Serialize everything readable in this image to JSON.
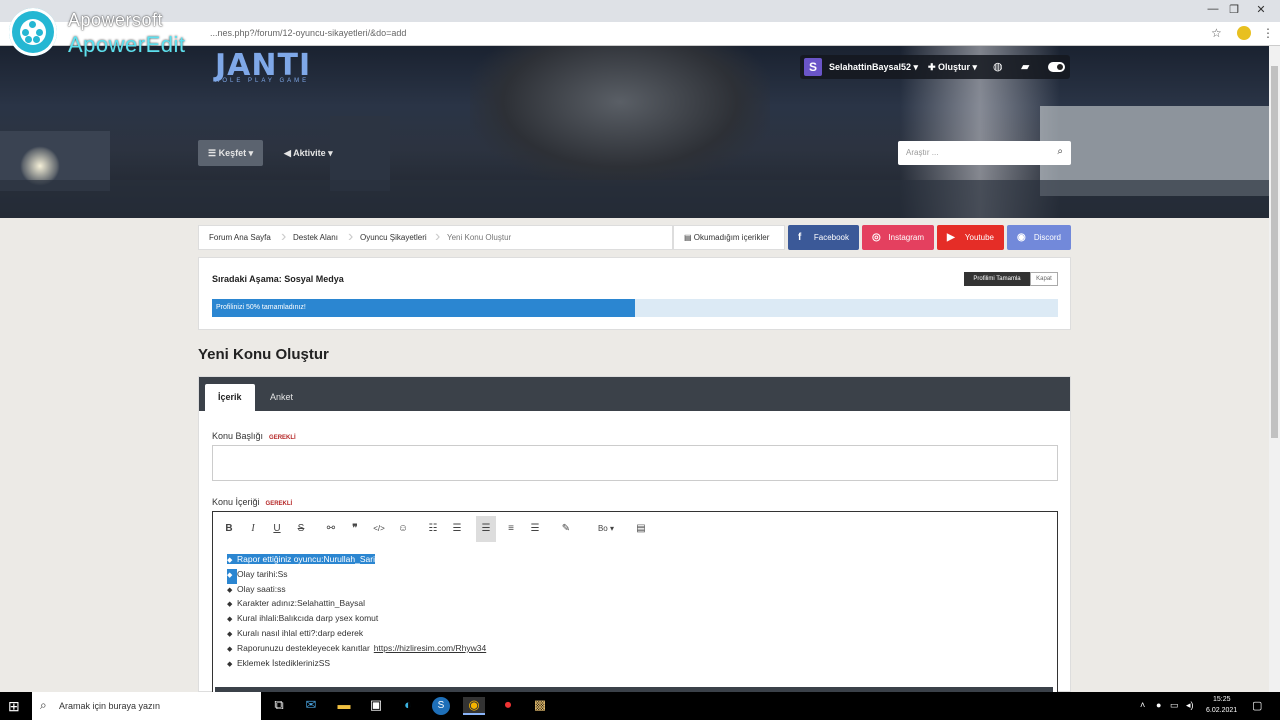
{
  "browser": {
    "url": "...nes.php?/forum/12-oyuncu-sikayetleri/&do=add",
    "window_controls": [
      "—",
      "❐",
      "✕"
    ]
  },
  "watermark": {
    "line1": "Apowersoft",
    "line2": "ApowerEdit"
  },
  "site": {
    "logo": "JANTI",
    "logo_sub": "ROLE PLAY GAME",
    "user_initial": "S",
    "username": "SelahattinBaysal52 ▾",
    "create_label": "✚ Oluştur ▾",
    "nav": {
      "kesfet": "Keşfet ▾",
      "aktivite": "Aktivite ▾"
    },
    "search_placeholder": "Araştır ..."
  },
  "breadcrumb": {
    "items": [
      "Forum Ana Sayfa",
      "Destek Alanı",
      "Oyuncu Şikayetleri",
      "Yeni Konu Oluştur"
    ],
    "unread": "Okumadığım içerikler"
  },
  "social": [
    {
      "label": "Facebook",
      "icon": "f",
      "color": "#3b5998"
    },
    {
      "label": "Instagram",
      "icon": "◎",
      "color": "#e4405f"
    },
    {
      "label": "Youtube",
      "icon": "▶",
      "color": "#e52d27"
    },
    {
      "label": "Discord",
      "icon": "◉",
      "color": "#7289da"
    }
  ],
  "progress": {
    "next_step": "Sıradaki Aşama: Sosyal Medya",
    "complete_btn": "Profilimi Tamamla",
    "close_btn": "Kapat",
    "text": "Profilinizi 50% tamamladınız!",
    "percent": 50
  },
  "form": {
    "page_title": "Yeni Konu Oluştur",
    "tabs": [
      "İçerik",
      "Anket"
    ],
    "title_label": "Konu Başlığı",
    "content_label": "Konu İçeriği",
    "required": "GEREKLİ",
    "title_value": "",
    "toolbar_format": "Bo",
    "lines": [
      {
        "text": "Rapor ettiğiniz oyuncu:Nurullah_Sari",
        "selected": true
      },
      {
        "text": "Olay tarihi:Ss",
        "selected": false
      },
      {
        "text": "Olay saati:ss",
        "selected": false
      },
      {
        "text": "Karakter adınız:Selahattin_Baysal",
        "selected": false
      },
      {
        "text": "Kural ihlali:Balıkcıda darp ysex komut",
        "selected": false
      },
      {
        "text": "Kuralı nasıl ihlal etti?:darp ederek",
        "selected": false
      },
      {
        "text": "Raporunuzu destekleyecek kanıtlar",
        "selected": false,
        "link": "https://hizliresim.com/Rhyw34"
      },
      {
        "text": "Eklemek İstediklerinizSS",
        "selected": false
      }
    ]
  },
  "taskbar": {
    "search_text": "Aramak için buraya yazın",
    "time": "15:25",
    "date": "6.02.2021"
  }
}
